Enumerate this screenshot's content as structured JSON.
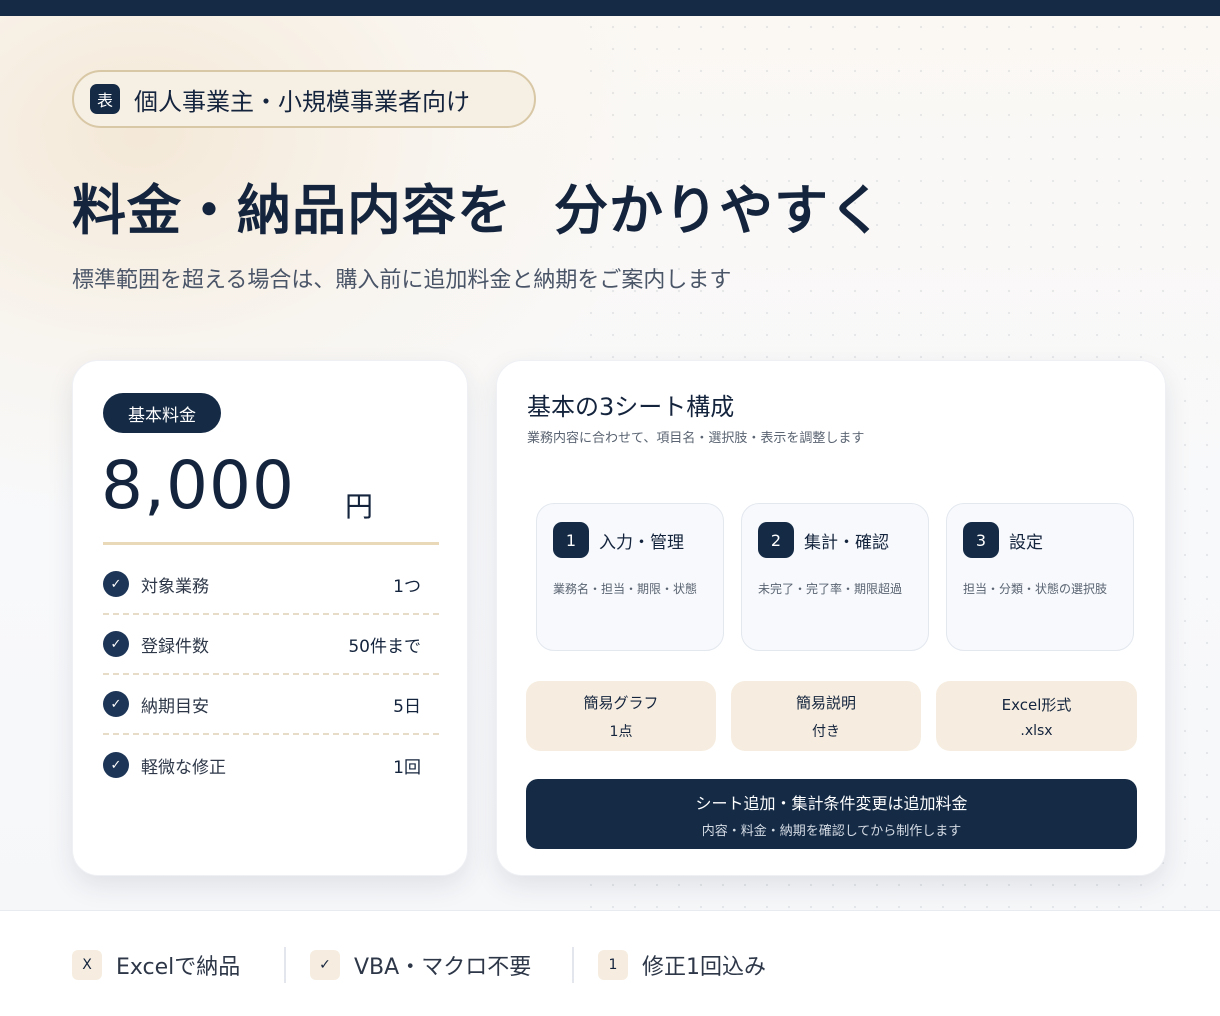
{
  "badge": {
    "icon": "表",
    "text": "個人事業主・小規模事業者向け"
  },
  "hero": {
    "title_plain": "料金・納品内容を",
    "title_highlight": "分かりやすく",
    "subtitle": "標準範囲を超える場合は、購入前に追加料金と納期をご案内します"
  },
  "price_card": {
    "pill": "基本料金",
    "price": "8,000",
    "unit": "円",
    "check_glyph": "✓",
    "specs": [
      {
        "label": "対象業務",
        "value": "1つ"
      },
      {
        "label": "登録件数",
        "value": "50件まで"
      },
      {
        "label": "納期目安",
        "value": "5日"
      },
      {
        "label": "軽微な修正",
        "value": "1回"
      }
    ]
  },
  "sheet_card": {
    "title": "基本の3シート構成",
    "subtitle": "業務内容に合わせて、項目名・選択肢・表示を調整します",
    "steps": [
      {
        "num": "1",
        "title": "入力・管理",
        "desc": "業務名・担当・期限・状態"
      },
      {
        "num": "2",
        "title": "集計・確認",
        "desc": "未完了・完了率・期限超過"
      },
      {
        "num": "3",
        "title": "設定",
        "desc": "担当・分類・状態の選択肢"
      }
    ],
    "features": [
      {
        "top": "簡易グラフ",
        "bottom": "1点"
      },
      {
        "top": "簡易説明",
        "bottom": "付き"
      },
      {
        "top": "Excel形式",
        "bottom": ".xlsx"
      }
    ],
    "note": {
      "main": "シート追加・集計条件変更は追加料金",
      "sub": "内容・料金・納期を確認してから制作します"
    }
  },
  "footer": {
    "items": [
      {
        "icon": "X",
        "text": "Excelで納品"
      },
      {
        "icon": "✓",
        "text": "VBA・マクロ不要"
      },
      {
        "icon": "1",
        "text": "修正1回込み"
      }
    ]
  },
  "colors": {
    "navy": "#142a45",
    "beige": "#f6ede0",
    "highlight": "#ead9b8"
  }
}
